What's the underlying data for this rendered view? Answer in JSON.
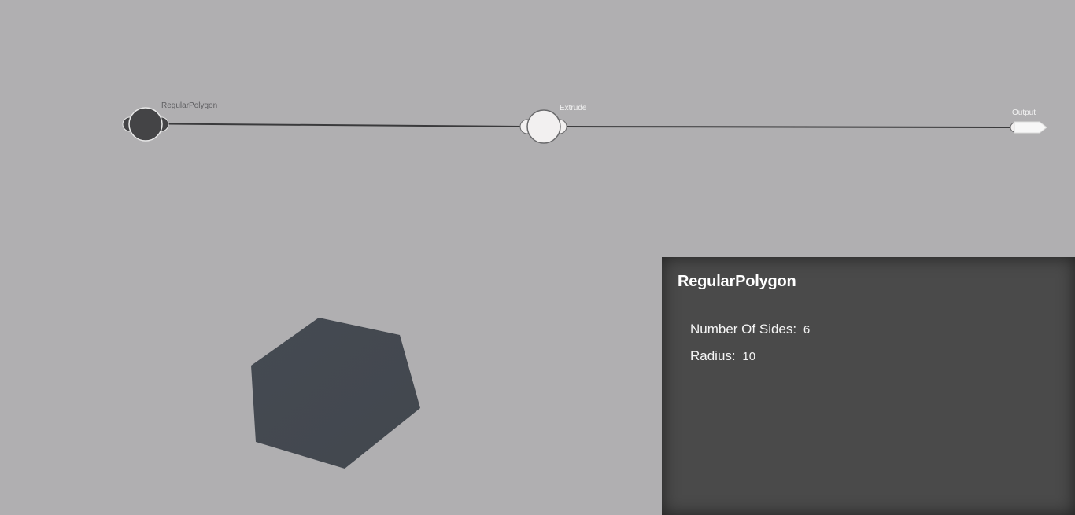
{
  "graph": {
    "nodes": [
      {
        "id": "regular-polygon",
        "label": "RegularPolygon",
        "selected": true
      },
      {
        "id": "extrude",
        "label": "Extrude",
        "selected": false
      },
      {
        "id": "output",
        "label": "Output",
        "selected": false
      }
    ],
    "colors": {
      "background": "#b0afb1",
      "wire": "#3a3a3c",
      "node_selected": "#444446",
      "node_default": "#f2f0f0"
    }
  },
  "viewport": {
    "shape_color": "#444950"
  },
  "panel": {
    "title": "RegularPolygon",
    "params": [
      {
        "label": "Number Of Sides:",
        "value": "6"
      },
      {
        "label": "Radius:",
        "value": "10"
      }
    ],
    "background": "#4a4a4a"
  }
}
